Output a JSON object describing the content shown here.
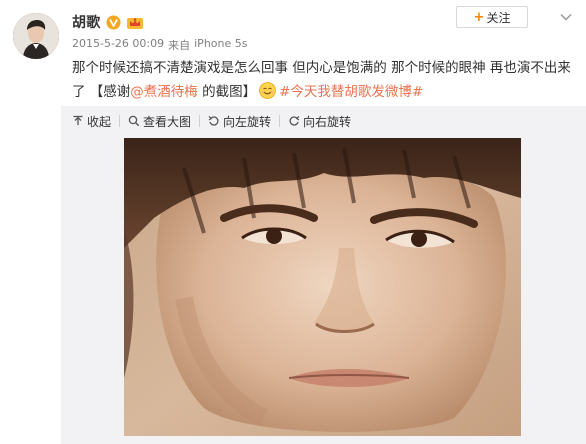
{
  "user": {
    "name": "胡歌",
    "avatar_icon": "avatar-photo",
    "verified_icon": "verified-v-badge",
    "member_icon": "crown-member-badge"
  },
  "meta": {
    "timestamp": "2015-5-26 00:09",
    "source_prefix": "来自",
    "device": "iPhone 5s"
  },
  "follow_button": {
    "plus": "+",
    "label": "关注"
  },
  "post": {
    "text_1": "那个时候还搞不清楚演戏是怎么回事 但内心是饱满的 那个时候的眼神 再也演不出来了 【感谢",
    "mention": "@煮酒待梅",
    "text_2": " 的截图】",
    "emoji": "smile-emoji",
    "topic": "#今天我替胡歌发微博#"
  },
  "toolbar": {
    "collapse": "收起",
    "view_large": "查看大图",
    "rotate_left": "向左旋转",
    "rotate_right": "向右旋转"
  },
  "colors": {
    "accent": "#eb7350",
    "follow_plus": "#ff8200",
    "verified": "#f5a623",
    "panel_bg": "#f2f2f5"
  },
  "image": {
    "description_icon": "portrait-photo"
  }
}
